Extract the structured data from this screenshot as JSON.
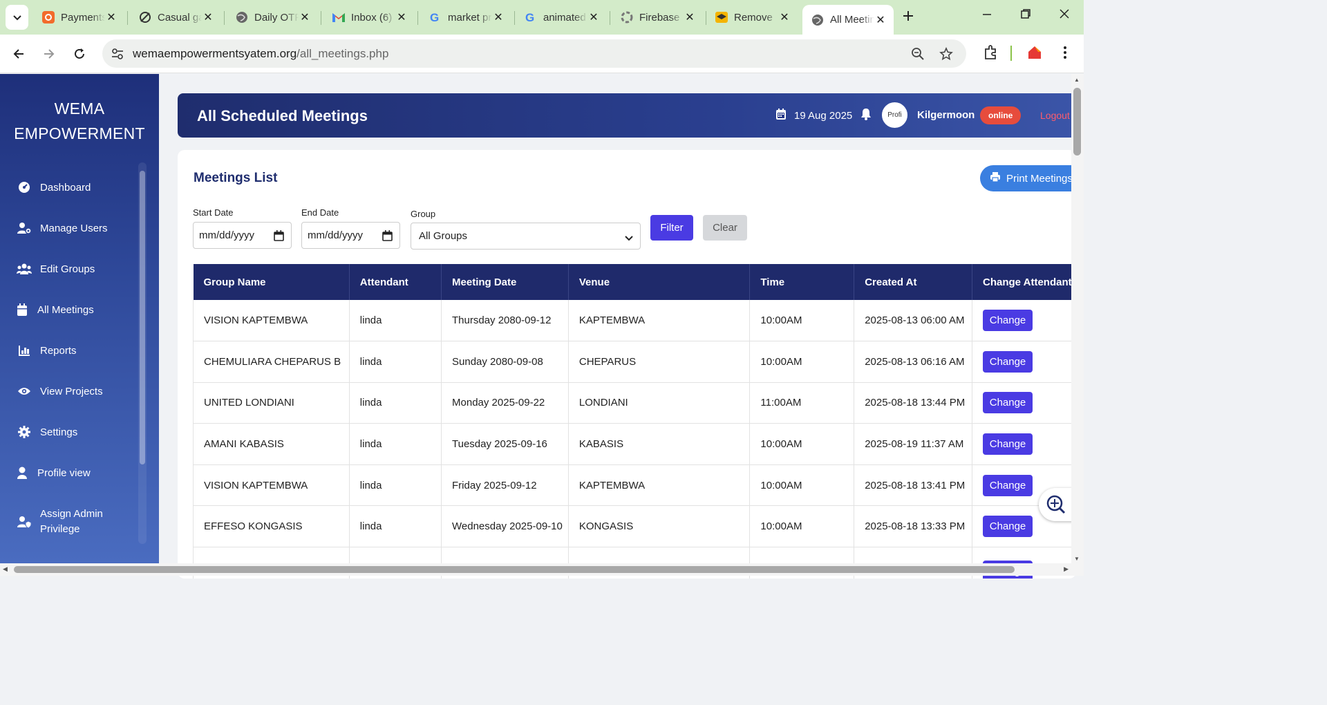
{
  "browser": {
    "tabs": [
      {
        "title": "Payments",
        "icon": "payment-app-icon"
      },
      {
        "title": "Casual game",
        "icon": "wand-icon"
      },
      {
        "title": "Daily OTP",
        "icon": "globe-icon"
      },
      {
        "title": "Inbox (6)",
        "icon": "gmail-icon"
      },
      {
        "title": "market prices",
        "icon": "google-icon"
      },
      {
        "title": "animated",
        "icon": "google-icon"
      },
      {
        "title": "Firebase",
        "icon": "firebase-icon"
      },
      {
        "title": "Remove",
        "icon": "graduation-cap-icon"
      },
      {
        "title": "All Meetings",
        "icon": "globe-icon",
        "active": true
      }
    ],
    "url_domain": "wemaempowermentsyatem.org",
    "url_path": "/all_meetings.php"
  },
  "sidebar": {
    "brand_line1": "WEMA",
    "brand_line2": "EMPOWERMENT",
    "items": [
      {
        "label": "Dashboard",
        "icon": "dashboard-icon"
      },
      {
        "label": "Manage Users",
        "icon": "user-cog-icon"
      },
      {
        "label": "Edit Groups",
        "icon": "users-icon"
      },
      {
        "label": "All Meetings",
        "icon": "calendar-icon"
      },
      {
        "label": "Reports",
        "icon": "chart-icon"
      },
      {
        "label": "View Projects",
        "icon": "eye-icon"
      },
      {
        "label": "Settings",
        "icon": "gear-icon"
      },
      {
        "label": "Profile view",
        "icon": "user-icon"
      },
      {
        "label": "Assign Admin Privilege",
        "label_line1": "Assign Admin",
        "label_line2": "Privilege",
        "icon": "user-shield-icon"
      }
    ]
  },
  "header": {
    "title": "All Scheduled Meetings",
    "date": "19 Aug 2025",
    "avatar_alt": "Profi",
    "username": "Kilgermoon",
    "status": "online",
    "logout": "Logout"
  },
  "meetings": {
    "title": "Meetings List",
    "print_label": "Print Meetings",
    "filters": {
      "start_label": "Start Date",
      "start_value": "mm/dd/yyyy",
      "end_label": "End Date",
      "end_value": "mm/dd/yyyy",
      "group_label": "Group",
      "group_value": "All Groups",
      "filter_label": "Filter",
      "clear_label": "Clear"
    },
    "columns": [
      "Group Name",
      "Attendant",
      "Meeting Date",
      "Venue",
      "Time",
      "Created At",
      "Change Attendant"
    ],
    "change_label": "Change",
    "rows": [
      [
        "VISION KAPTEMBWA",
        "linda",
        "Thursday 2080-09-12",
        "KAPTEMBWA",
        "10:00AM",
        "2025-08-13 06:00 AM"
      ],
      [
        "CHEMULIARA CHEPARUS B",
        "linda",
        "Sunday 2080-09-08",
        "CHEPARUS",
        "10:00AM",
        "2025-08-13 06:16 AM"
      ],
      [
        "UNITED LONDIANI",
        "linda",
        "Monday 2025-09-22",
        "LONDIANI",
        "11:00AM",
        "2025-08-18 13:44 PM"
      ],
      [
        "AMANI KABASIS",
        "linda",
        "Tuesday 2025-09-16",
        "KABASIS",
        "10:00AM",
        "2025-08-19 11:37 AM"
      ],
      [
        "VISION KAPTEMBWA",
        "linda",
        "Friday 2025-09-12",
        "KAPTEMBWA",
        "10:00AM",
        "2025-08-18 13:41 PM"
      ],
      [
        "EFFESO KONGASIS",
        "linda",
        "Wednesday 2025-09-10",
        "KONGASIS",
        "10:00AM",
        "2025-08-18 13:33 PM"
      ]
    ]
  },
  "colors": {
    "sidebar_top": "#1e2f7a",
    "sidebar_bottom": "#4a6cc0",
    "header_bg": "#1f2d6e",
    "table_header": "#1f2a6b",
    "primary_button": "#4a3be3",
    "print_button": "#3a7fe0",
    "online_badge": "#e74c3c",
    "tabstrip": "#d3ebc9"
  }
}
